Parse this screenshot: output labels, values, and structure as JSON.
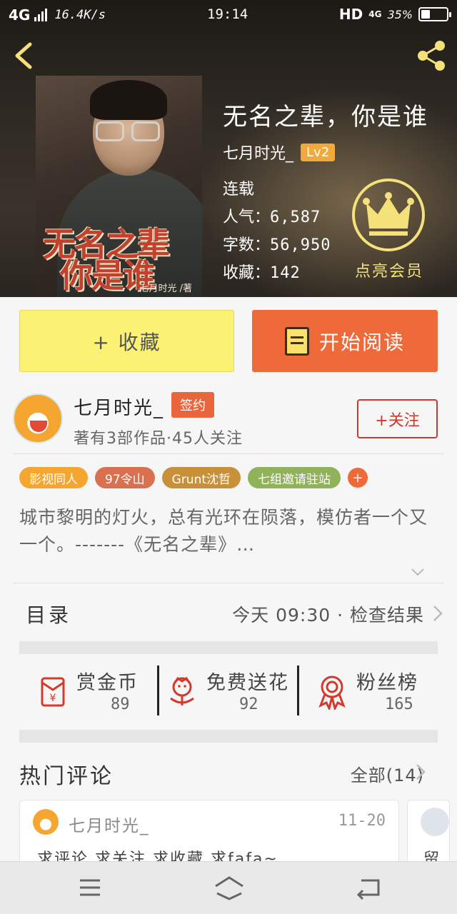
{
  "status_bar": {
    "network": "4G",
    "speed": "16.4K/s",
    "time": "19:14",
    "hd": "HD",
    "mobile": "4G",
    "battery": "35%",
    "battery_level": 0.35
  },
  "book": {
    "title": "无名之辈，你是谁",
    "author": "七月时光_",
    "level": "Lv2",
    "status": "连载",
    "popularity_label": "人气：",
    "popularity": "6,587",
    "words_label": "字数：",
    "words": "56,950",
    "collects_label": "收藏：",
    "collects": "142",
    "vip_label": "点亮会员",
    "cover": {
      "title_line1": "无名之辈",
      "title_line2": "你是谁",
      "author_text": "七月时光 /著"
    }
  },
  "actions": {
    "collect_label": "+ 收藏",
    "read_label": "开始阅读"
  },
  "author_card": {
    "name": "七月时光_",
    "badge": "签约",
    "meta": "著有3部作品·45人关注",
    "follow_label": "+关注"
  },
  "tags": [
    {
      "label": "影视同人",
      "color": "#f4a630"
    },
    {
      "label": "97令山",
      "color": "#d9704f"
    },
    {
      "label": "Grunt沈哲",
      "color": "#c9903a"
    },
    {
      "label": "七组邀请驻站",
      "color": "#8fb25a"
    }
  ],
  "intro": "城市黎明的灯火，总有光环在陨落，模仿者一个又一个。-------《无名之辈》…",
  "toc": {
    "label": "目录",
    "latest": "今天 09:30 · 检查结果"
  },
  "rewards": [
    {
      "label": "赏金币",
      "count": "89"
    },
    {
      "label": "免费送花",
      "count": "92"
    },
    {
      "label": "粉丝榜",
      "count": "165"
    }
  ],
  "hot_comments": {
    "title": "热门评论",
    "all_label": "全部(14)",
    "items": [
      {
        "user": "七月时光_",
        "date": "11-20",
        "text": "求评论 求关注 求收藏 求fafa~"
      },
      {
        "user": "",
        "date": "",
        "text": "留"
      }
    ]
  },
  "colors": {
    "accent_orange": "#ee6a3a",
    "collect_yellow": "#fbf273",
    "vip_gold": "#f4e17a",
    "follow_red": "#c93a2e"
  },
  "icons": [
    "back-icon",
    "share-icon",
    "crown-icon",
    "book-icon",
    "red-envelope-icon",
    "flower-icon",
    "medal-icon",
    "chevron-right-icon",
    "chevron-down-icon",
    "menu-icon",
    "home-icon",
    "return-icon"
  ]
}
